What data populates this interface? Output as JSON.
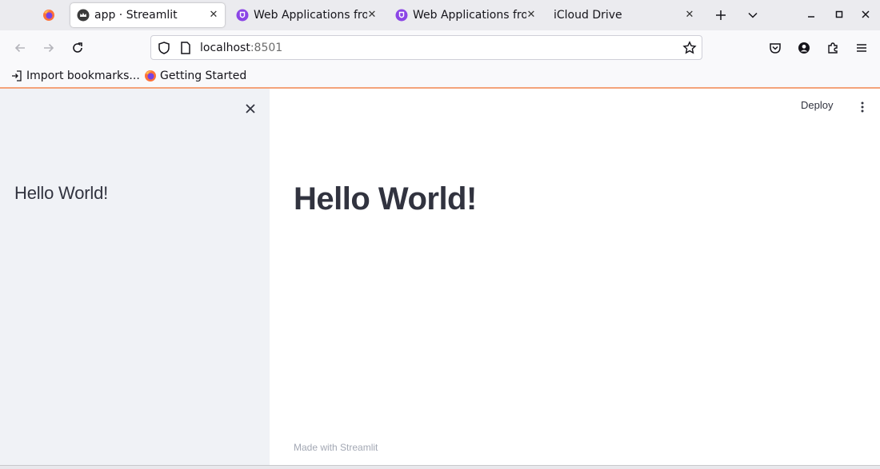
{
  "browser": {
    "tabs": [
      {
        "title": "app · Streamlit",
        "favicon": "streamlit-crown-icon",
        "active": true
      },
      {
        "title": "Web Applications fror",
        "favicon": "purple-shield-icon",
        "active": false
      },
      {
        "title": "Web Applications fror",
        "favicon": "purple-shield-icon",
        "active": false
      },
      {
        "title": "iCloud Drive",
        "favicon": "",
        "active": false
      }
    ],
    "close_glyph": "✕",
    "url": {
      "host": "localhost",
      "port": ":8501"
    },
    "bookmarks": [
      {
        "label": "Import bookmarks...",
        "icon": "import-icon"
      },
      {
        "label": "Getting Started",
        "icon": "firefox-icon"
      }
    ],
    "accent_color": "#f4a37a"
  },
  "app": {
    "sidebar": {
      "title": "Hello World!",
      "close_glyph": "✕",
      "background": "#f0f2f6"
    },
    "header": {
      "deploy_label": "Deploy"
    },
    "main": {
      "title": "Hello World!"
    },
    "footer": {
      "text": "Made with Streamlit"
    }
  }
}
